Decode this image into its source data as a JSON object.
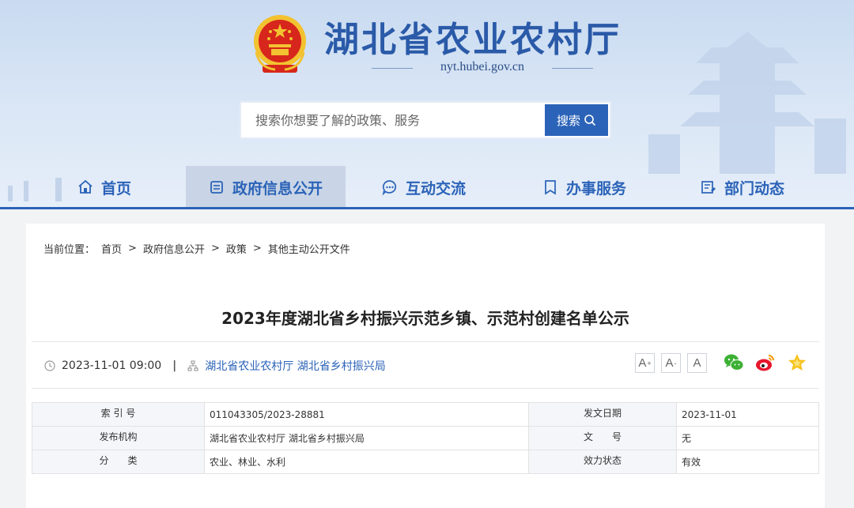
{
  "site": {
    "title": "湖北省农业农村厅",
    "domain": "nyt.hubei.gov.cn"
  },
  "search": {
    "placeholder": "搜索你想要了解的政策、服务",
    "button_label": "搜索"
  },
  "nav": {
    "items": [
      {
        "label": "首页",
        "icon": "home-icon"
      },
      {
        "label": "政府信息公开",
        "icon": "document-icon",
        "active": true
      },
      {
        "label": "互动交流",
        "icon": "chat-icon"
      },
      {
        "label": "办事服务",
        "icon": "bookmark-icon"
      },
      {
        "label": "部门动态",
        "icon": "news-icon"
      }
    ]
  },
  "breadcrumb": {
    "prefix": "当前位置：",
    "items": [
      "首页",
      "政府信息公开",
      "政策",
      "其他主动公开文件"
    ],
    "separator": ">"
  },
  "article": {
    "title": "2023年度湖北省乡村振兴示范乡镇、示范村创建名单公示",
    "datetime": "2023-11-01 09:00",
    "divider": "|",
    "publisher": "湖北省农业农村厅 湖北省乡村振兴局"
  },
  "font_size_buttons": [
    {
      "label": "A",
      "sup": "+"
    },
    {
      "label": "A",
      "sup": "-"
    },
    {
      "label": "A",
      "sup": ""
    }
  ],
  "share": [
    "wechat-icon",
    "weibo-icon",
    "favorite-star-icon"
  ],
  "info_table": {
    "rows": [
      {
        "k1": "索 引 号",
        "v1": "011043305/2023-28881",
        "k2": "发文日期",
        "v2": "2023-11-01"
      },
      {
        "k1": "发布机构",
        "v1": "湖北省农业农村厅 湖北省乡村振兴局",
        "k2": "文　　号",
        "v2": "无"
      },
      {
        "k1": "分　　类",
        "v1": "农业、林业、水利",
        "k2": "效力状态",
        "v2": "有效"
      }
    ]
  },
  "colors": {
    "brand_blue": "#2b63b8",
    "title_blue": "#2a5aa8",
    "emblem_red": "#d7261b",
    "emblem_gold": "#f2c230"
  }
}
